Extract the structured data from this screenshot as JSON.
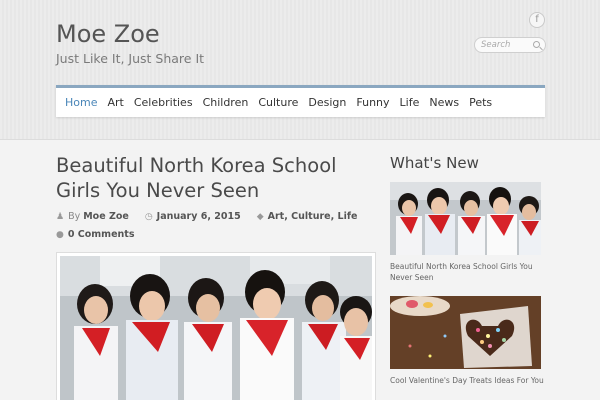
{
  "site": {
    "title": "Moe Zoe",
    "tagline": "Just Like It, Just Share It"
  },
  "social": {
    "facebook_glyph": "f"
  },
  "search": {
    "placeholder": "Search"
  },
  "nav": {
    "items": [
      {
        "label": "Home",
        "active": true
      },
      {
        "label": "Art"
      },
      {
        "label": "Celebrities"
      },
      {
        "label": "Children"
      },
      {
        "label": "Culture"
      },
      {
        "label": "Design"
      },
      {
        "label": "Funny"
      },
      {
        "label": "Life"
      },
      {
        "label": "News"
      },
      {
        "label": "Pets"
      }
    ]
  },
  "post": {
    "title": "Beautiful North Korea School Girls You Never Seen",
    "by": "By",
    "author": "Moe Zoe",
    "date": "January 6, 2015",
    "categories": [
      "Art",
      "Culture",
      "Life"
    ],
    "comments": "0 Comments"
  },
  "sidebar": {
    "title": "What's New",
    "items": [
      {
        "caption": "Beautiful North Korea School Girls You Never Seen"
      },
      {
        "caption": "Cool Valentine's Day Treats Ideas For You"
      }
    ]
  },
  "colors": {
    "accent": "#4a86b8",
    "nav_border": "#8aa7c0",
    "text": "#444444"
  }
}
